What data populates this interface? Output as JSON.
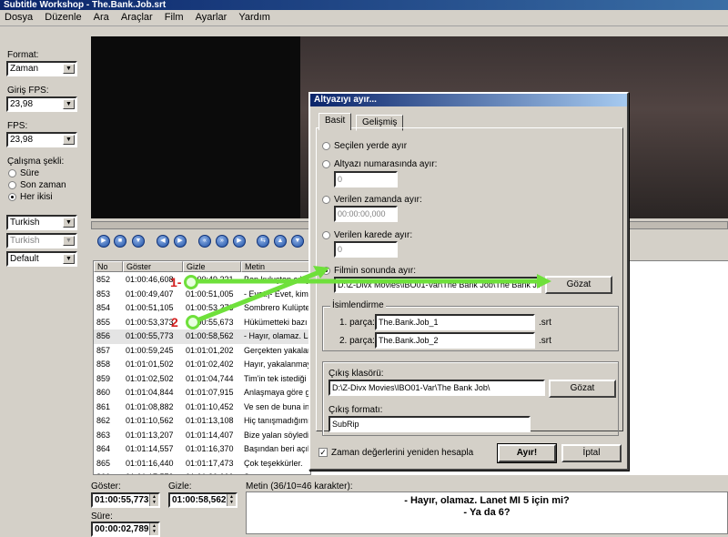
{
  "window": {
    "title": "Subtitle Workshop - The.Bank.Job.srt"
  },
  "menu": [
    "Dosya",
    "Düzenle",
    "Ara",
    "Araçlar",
    "Film",
    "Ayarlar",
    "Yardım"
  ],
  "left_panel": {
    "format_label": "Format:",
    "format_value": "Zaman",
    "input_fps_label": "Giriş FPS:",
    "input_fps_value": "23,98",
    "fps_label": "FPS:",
    "fps_value": "23,98",
    "mode_label": "Çalışma şekli:",
    "mode_options": [
      "Süre",
      "Son zaman",
      "Her ikisi"
    ],
    "mode_selected": "Her ikisi",
    "lang1": "Turkish",
    "lang2": "Turkish",
    "style": "Default"
  },
  "subtitle_list": {
    "headers": [
      "No",
      "Göster",
      "Gizle",
      "Metin"
    ],
    "selected_no": "856",
    "rows": [
      {
        "no": "852",
        "show": "01:00:46,608",
        "hide": "01:00:49,221",
        "text": "Ben kuluşten çıkıyo"
      },
      {
        "no": "853",
        "show": "01:00:49,407",
        "hide": "01:00:51,005",
        "text": "- Evet.|- Evet, kim"
      },
      {
        "no": "854",
        "show": "01:00:51,105",
        "hide": "01:00:53,273",
        "text": "Sombrero Kulüpte"
      },
      {
        "no": "855",
        "show": "01:00:53,373",
        "hide": "01:00:55,673",
        "text": "Hükümetteki bazı"
      },
      {
        "no": "856",
        "show": "01:00:55,773",
        "hide": "01:00:58,562",
        "text": "- Hayır, olamaz. La"
      },
      {
        "no": "857",
        "show": "01:00:59,245",
        "hide": "01:01:01,202",
        "text": "Gerçekten yakalar"
      },
      {
        "no": "858",
        "show": "01:01:01,502",
        "hide": "01:01:02,402",
        "text": "Hayır, yakalanmay"
      },
      {
        "no": "859",
        "show": "01:01:02,502",
        "hide": "01:01:04,744",
        "text": "Tim'in tek istediği"
      },
      {
        "no": "860",
        "show": "01:01:04,844",
        "hide": "01:01:07,915",
        "text": "Anlaşmaya göre g"
      },
      {
        "no": "861",
        "show": "01:01:08,882",
        "hide": "01:01:10,452",
        "text": "Ve sen de buna in"
      },
      {
        "no": "862",
        "show": "01:01:10,562",
        "hide": "01:01:13,108",
        "text": "Hiç tanışmadığımız"
      },
      {
        "no": "863",
        "show": "01:01:13,207",
        "hide": "01:01:14,407",
        "text": "Bize yalan söyledi"
      },
      {
        "no": "864",
        "show": "01:01:14,557",
        "hide": "01:01:16,370",
        "text": "Başından beri açık"
      },
      {
        "no": "865",
        "show": "01:01:16,440",
        "hide": "01:01:17,473",
        "text": "Çok teşekkürler."
      },
      {
        "no": "866",
        "show": "01:01:17,573",
        "hide": "01:01:20,000",
        "text": "Sence uyuşturucu"
      }
    ]
  },
  "bottom": {
    "show_label": "Göster:",
    "show_value": "01:00:55,773",
    "hide_label": "Gizle:",
    "hide_value": "01:00:58,562",
    "duration_label": "Süre:",
    "duration_value": "00:00:02,789",
    "text_label": "Metin (36/10=46 karakter):",
    "text_line1": "- Hayır, olamaz. Lanet MI 5 için mi?",
    "text_line2": "- Ya da 6?"
  },
  "dialog": {
    "title": "Altyazıyı ayır...",
    "tabs": [
      "Basit",
      "Gelişmiş"
    ],
    "active_tab": "Basit",
    "options": [
      "Seçilen yerde ayır",
      "Altyazı numarasında ayır:",
      "Verilen zamanda ayır:",
      "Verilen karede ayır:",
      "Filmin sonunda ayır:"
    ],
    "selected_option": "Filmin sonunda ayır:",
    "subtitle_number_value": "0",
    "time_value": "00:00:00,000",
    "frame_value": "0",
    "movie_path": "D:\\Z-Divx Movies\\IBO01-Var\\The Bank Job\\The Bank Job.",
    "browse_label": "Gözat",
    "names_group": "İsimlendirme",
    "part1_label": "1. parça:",
    "part1_value": "The.Bank.Job_1",
    "part2_label": "2. parça:",
    "part2_value": "The.Bank.Job_2",
    "ext": ".srt",
    "output_folder_label": "Çıkış klasörü:",
    "output_folder_value": "D:\\Z-Divx Movies\\IBO01-Var\\The Bank Job\\",
    "browse2_label": "Gözat",
    "output_format_label": "Çıkış formatı:",
    "output_format_value": "SubRip",
    "recalc_label": "Zaman değerlerini yeniden hesapla",
    "split_button": "Ayır!",
    "cancel_button": "İptal"
  },
  "annotations": [
    "1-",
    "2"
  ],
  "colors": {
    "arrow": "#6fe03b",
    "annotation_number": "#d42020",
    "title_bar": "#0a246a"
  }
}
